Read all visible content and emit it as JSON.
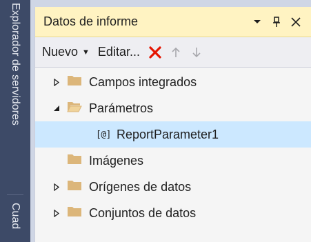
{
  "sidebar": {
    "tabs": [
      {
        "label": "Explorador de servidores"
      },
      {
        "label": "Cuad"
      }
    ]
  },
  "panel": {
    "title": "Datos de informe",
    "controls": {
      "dropdown": "dropdown-arrow-icon",
      "pin": "pin-icon",
      "close": "close-icon"
    }
  },
  "toolbar": {
    "new_label": "Nuevo",
    "edit_label": "Editar...",
    "delete_icon": "delete-x-icon",
    "up_icon": "move-up-icon",
    "down_icon": "move-down-icon",
    "delete_color": "#e51400"
  },
  "tree": {
    "items": [
      {
        "label": "Campos integrados"
      },
      {
        "label": "Parámetros"
      },
      {
        "label": "ReportParameter1",
        "icon_text": "[@]"
      },
      {
        "label": "Imágenes"
      },
      {
        "label": "Orígenes de datos"
      },
      {
        "label": "Conjuntos de datos"
      }
    ],
    "folder_color": "#dcb67a",
    "selected_color": "#cce8ff"
  }
}
